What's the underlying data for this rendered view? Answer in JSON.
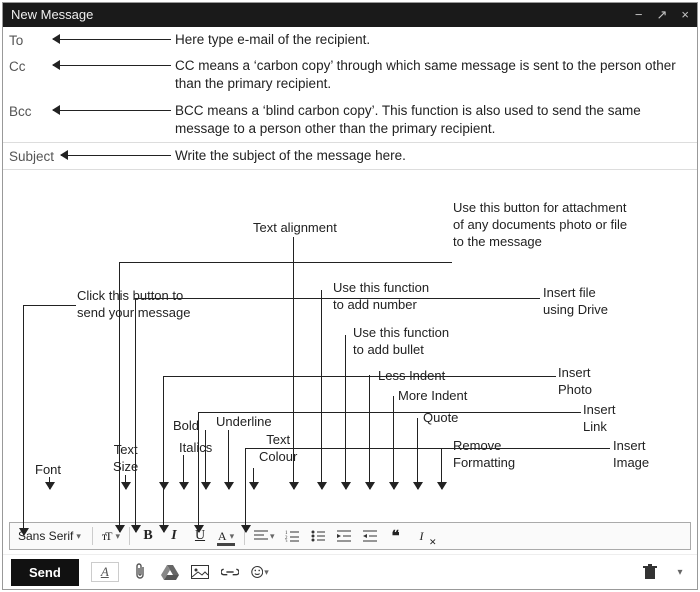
{
  "window": {
    "title": "New Message",
    "min_label": "−",
    "pop_label": "↗",
    "close_label": "×"
  },
  "fields": {
    "to_label": "To",
    "cc_label": "Cc",
    "bcc_label": "Bcc",
    "subject_label": "Subject"
  },
  "desc": {
    "to": "Here type e-mail of the recipient.",
    "cc": "CC means a ‘carbon copy’ through which same message is sent to the person other than the primary recipient.",
    "bcc": "BCC means a ‘blind carbon copy’. This function is also used to send the same message to a person other than the primary recipient.",
    "subject": "Write the subject of the message here."
  },
  "notes": {
    "send": "Click this button to\nsend your message",
    "font": "Font",
    "size": "Text\nSize",
    "bold": "Bold",
    "italic": "Italics",
    "underline": "Underline",
    "colour": "Text\nColour",
    "align": "Text alignment",
    "numlist": "Use this function\nto add number",
    "bullist": "Use this function\nto add bullet",
    "lessindent": "Less Indent",
    "moreindent": "More Indent",
    "quote": "Quote",
    "removefmt": "Remove\nFormatting",
    "attach": "Use this button for attachment\nof any documents photo or file\nto the message",
    "drive": "Insert file\nusing Drive",
    "photo": "Insert\nPhoto",
    "link": "Insert\nLink",
    "image": "Insert\nImage"
  },
  "toolbar": {
    "font_name": "Sans Serif",
    "bold_glyph": "B",
    "italic_glyph": "I",
    "underline_glyph": "U",
    "colour_glyph": "A"
  },
  "sendbar": {
    "send_label": "Send",
    "fmt_glyph": "A"
  }
}
